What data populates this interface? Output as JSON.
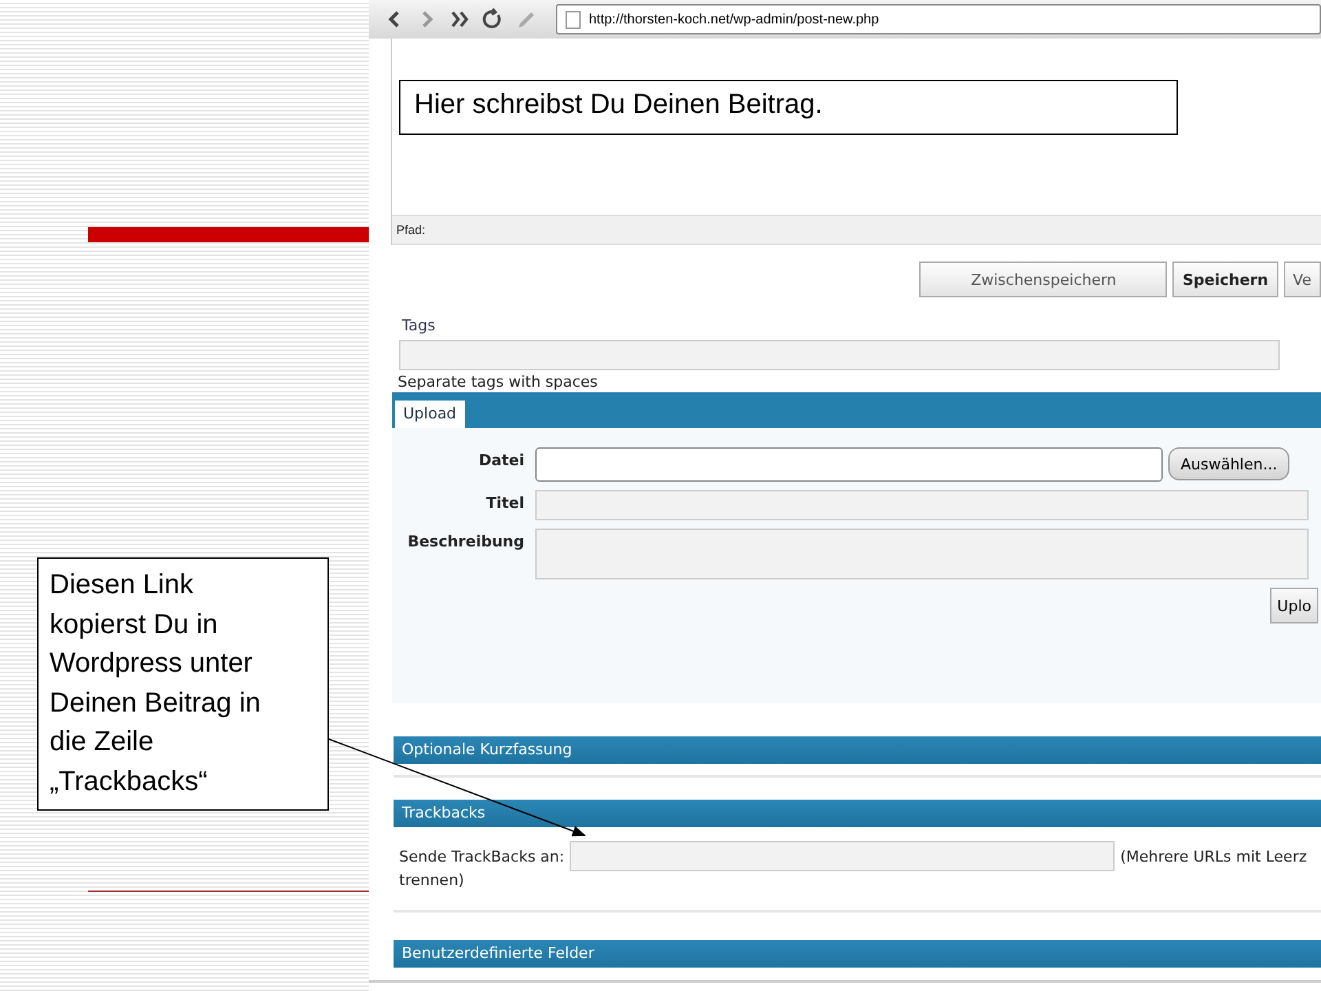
{
  "callouts": [
    {
      "text": "Hier schreibst Du Deinen Beitrag."
    },
    {
      "text": "Diesen Link kopierst Du in Wordpress unter Deinen Beitrag in die Zeile „Trackbacks“"
    }
  ],
  "browser": {
    "url": "http://thorsten-koch.net/wp-admin/post-new.php"
  },
  "editor": {
    "path_label": "Pfad:"
  },
  "buttons": [
    {
      "label": "Zwischenspeichern",
      "kind": "secondary"
    },
    {
      "label": "Speichern",
      "kind": "primary"
    },
    {
      "label": "Ve",
      "kind": "secondary"
    }
  ],
  "tags": {
    "label": "Tags",
    "hint": "Separate tags with spaces"
  },
  "upload": {
    "tabs": [
      {
        "label": "Upload",
        "selected": true
      }
    ],
    "fields": [
      {
        "label": "Datei",
        "kind": "file",
        "button": "Auswählen..."
      },
      {
        "label": "Titel",
        "kind": "text"
      },
      {
        "label": "Beschreibung",
        "kind": "textarea"
      }
    ],
    "submit": "Uplo"
  },
  "sections": [
    {
      "title": "Optionale Kurzfassung"
    },
    {
      "title": "Trackbacks",
      "field_label": "Sende TrackBacks an:",
      "note": "(Mehrere URLs mit Leerz",
      "note_wrap": "trennen)"
    },
    {
      "title": "Benutzerdefinierte Felder"
    }
  ]
}
